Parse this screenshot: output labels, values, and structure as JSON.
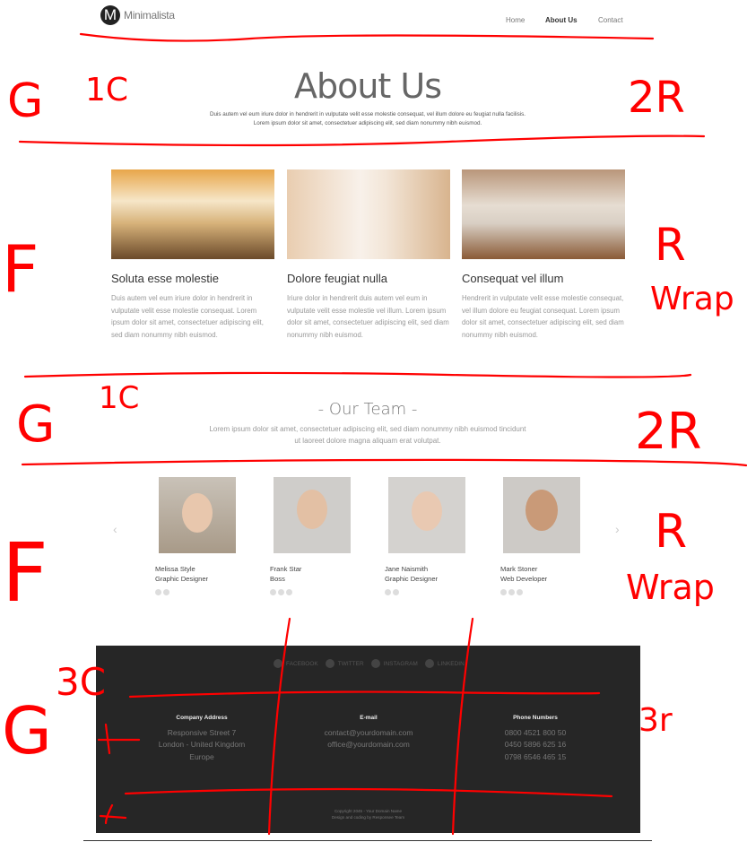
{
  "header": {
    "logo_letter": "M",
    "logo_text": "Minimalista",
    "nav": [
      "Home",
      "About Us",
      "Contact"
    ],
    "active_nav": "About Us"
  },
  "hero": {
    "title": "About Us",
    "text_1": "Duis autem vel eum iriure dolor in hendrerit in vulputate velit esse molestie consequat, vel illum dolore eu feugiat nulla facilisis.",
    "text_2": "Lorem ipsum dolor sit amet, consectetuer adipiscing elit, sed diam nonummy nibh euismod."
  },
  "features": [
    {
      "title": "Soluta esse molestie",
      "body": "Duis autem vel eum iriure dolor in hendrerit in vulputate velit esse molestie consequat. Lorem ipsum dolor sit amet, consectetuer adipiscing elit, sed diam nonummy nibh euismod."
    },
    {
      "title": "Dolore feugiat nulla",
      "body": "Iriure dolor in hendrerit duis autem vel eum in vulputate velit esse molestie vel illum. Lorem ipsum dolor sit amet, consectetuer adipiscing elit, sed diam nonummy nibh euismod."
    },
    {
      "title": "Consequat vel illum",
      "body": "Hendrerit in vulputate velit esse molestie consequat, vel illum dolore eu feugiat consequat. Lorem ipsum dolor sit amet, consectetuer adipiscing elit, sed diam nonummy nibh euismod."
    }
  ],
  "team": {
    "title": "- Our Team -",
    "text": "Lorem ipsum dolor sit amet, consectetuer adipiscing elit, sed diam nonummy nibh euismod tincidunt ut laoreet dolore magna aliquam erat volutpat.",
    "prev_icon": "chevron-left-icon",
    "next_icon": "chevron-right-icon",
    "members": [
      {
        "name": "Melissa Style",
        "role": "Graphic Designer",
        "socials": 2
      },
      {
        "name": "Frank Star",
        "role": "Boss",
        "socials": 3
      },
      {
        "name": "Jane Naismith",
        "role": "Graphic Designer",
        "socials": 2
      },
      {
        "name": "Mark Stoner",
        "role": "Web Developer",
        "socials": 3
      }
    ]
  },
  "footer": {
    "social": [
      "FACEBOOK",
      "TWITTER",
      "INSTAGRAM",
      "LINKEDIN"
    ],
    "columns": [
      {
        "heading": "Company Address",
        "lines": [
          "Responsive Street 7",
          "London - United Kingdom",
          "Europe"
        ]
      },
      {
        "heading": "E-mail",
        "lines": [
          "contact@yourdomain.com",
          "office@yourdomain.com"
        ]
      },
      {
        "heading": "Phone Numbers",
        "lines": [
          "0800 4521 800 50",
          "0450 5896 625 16",
          "0798 6546 465 15"
        ]
      }
    ],
    "copyright_1": "Copyright 2045 - Your Domain Name",
    "copyright_2": "Design and coding by Responsee Team"
  },
  "annotations": {
    "color": "#ff0000",
    "labels": [
      "G",
      "1C",
      "2R",
      "F",
      "R",
      "Wrap",
      "G",
      "1C",
      "2R",
      "F",
      "R",
      "Wrap",
      "3C",
      "G",
      "3r"
    ]
  }
}
